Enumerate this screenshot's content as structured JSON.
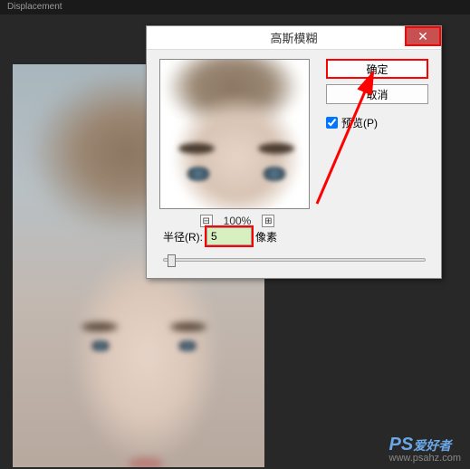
{
  "tab": {
    "title": "Displacement"
  },
  "dialog": {
    "title": "高斯模糊",
    "ok_label": "确定",
    "cancel_label": "取消",
    "preview_label": "预览(P)",
    "preview_checked": true,
    "zoom": {
      "minus": "⊟",
      "plus": "⊞",
      "value": "100%"
    },
    "radius": {
      "label": "半径(R):",
      "value": "5",
      "unit": "像素"
    }
  },
  "watermark": {
    "logo": "PS",
    "text": "爱好者",
    "url": "www.psahz.com"
  }
}
